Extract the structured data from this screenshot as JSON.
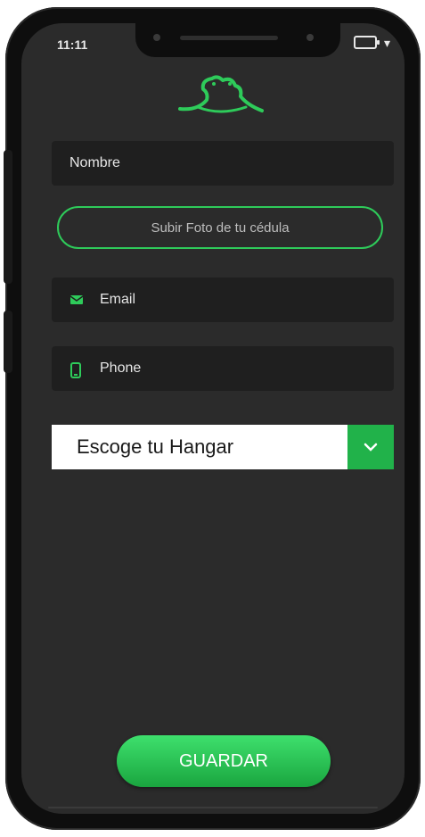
{
  "status_bar": {
    "time": "11:11",
    "battery_icon": "battery-icon",
    "wifi_icon": "wifi-icon"
  },
  "logo": {
    "icon": "frog-logo-icon",
    "color": "#2ecb5a"
  },
  "form": {
    "name_placeholder": "Nombre",
    "upload_label": "Subir Foto de tu cédula",
    "email_placeholder": "Email",
    "email_icon": "email-icon",
    "phone_placeholder": "Phone",
    "phone_icon": "phone-icon",
    "hangar_select": {
      "selected": "Escoge tu Hangar",
      "arrow_icon": "chevron-down-icon"
    },
    "save_label": "GUARDAR"
  },
  "colors": {
    "accent": "#2ecb5a",
    "screen_bg": "#2b2b2b",
    "field_bg": "#1f1f1f"
  }
}
